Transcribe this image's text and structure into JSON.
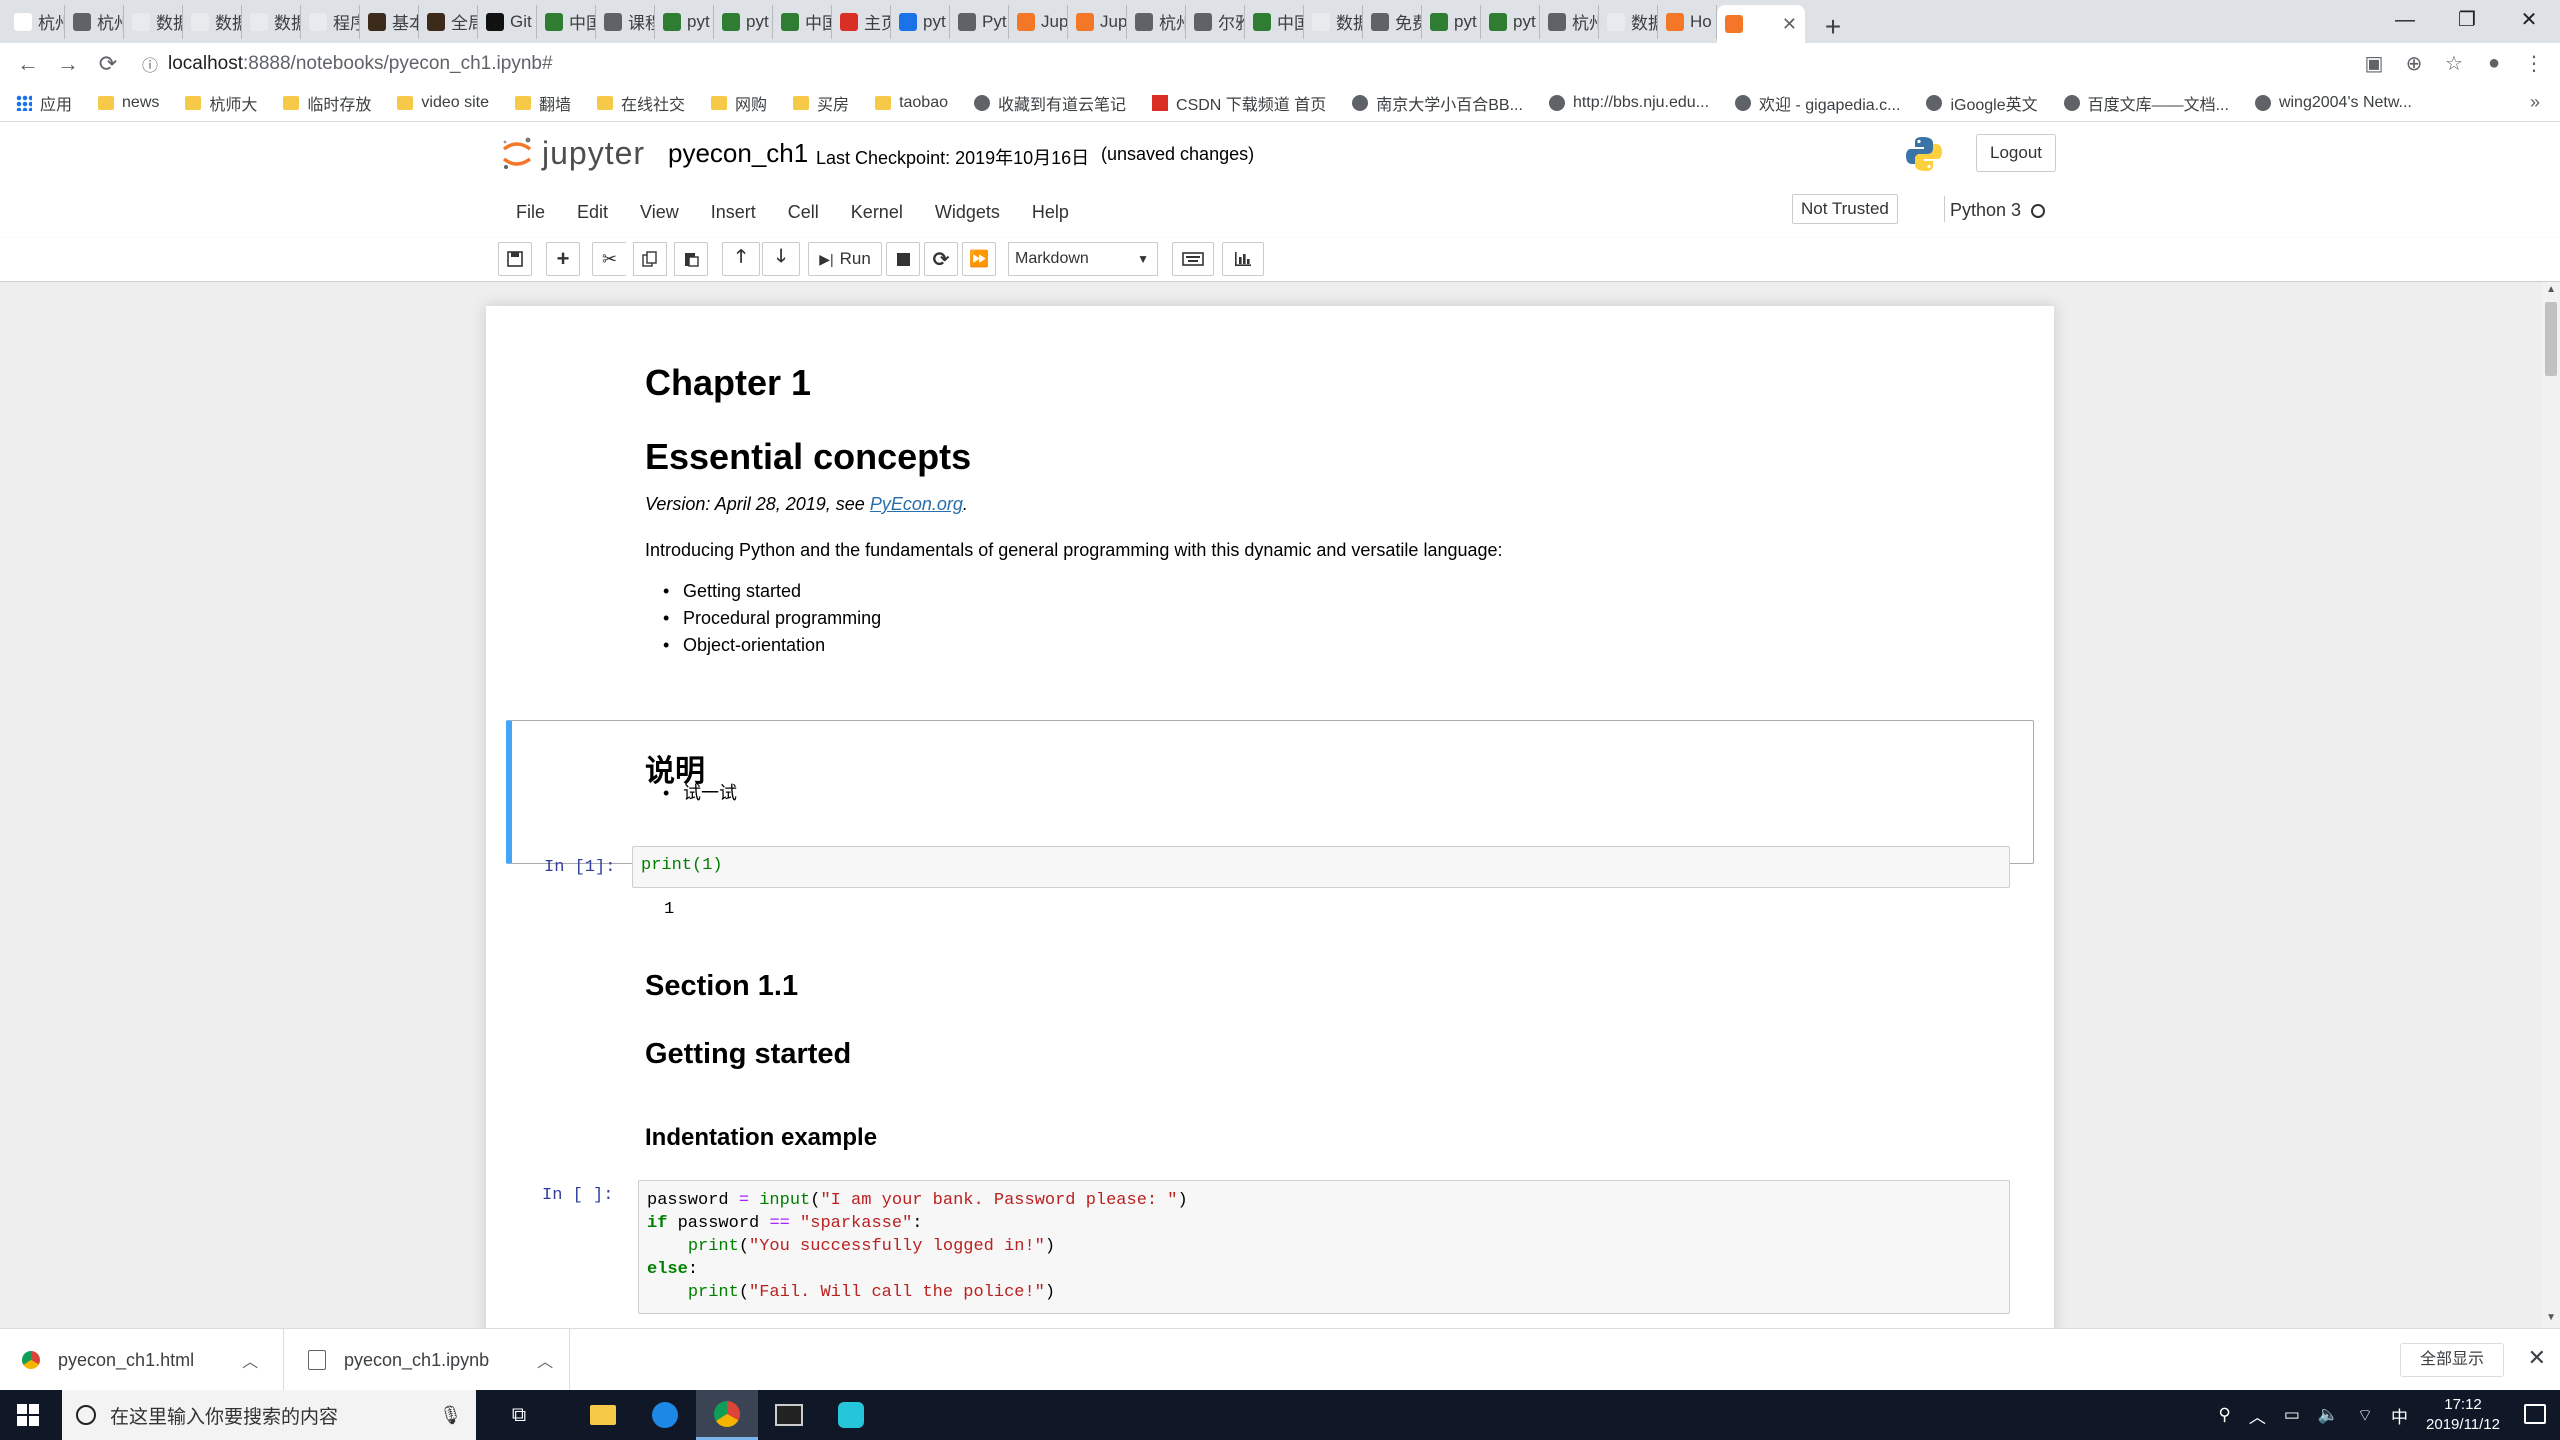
{
  "browser": {
    "tabs": [
      {
        "label": "杭州",
        "color": "#ffffff"
      },
      {
        "label": "杭州",
        "color": "#5f6368"
      },
      {
        "label": "数据",
        "color": "#e8eaed"
      },
      {
        "label": "数据",
        "color": "#e8eaed"
      },
      {
        "label": "数据",
        "color": "#e8eaed"
      },
      {
        "label": "程序",
        "color": "#e8eaed"
      },
      {
        "label": "基本",
        "color": "#3c2a1a"
      },
      {
        "label": "全局",
        "color": "#3c2a1a"
      },
      {
        "label": "Git",
        "color": "#111111"
      },
      {
        "label": "中国",
        "color": "#2e7d32"
      },
      {
        "label": "课程",
        "color": "#5f6368"
      },
      {
        "label": "pyt",
        "color": "#2e7d32"
      },
      {
        "label": "pyt",
        "color": "#2e7d32"
      },
      {
        "label": "中国",
        "color": "#2e7d32"
      },
      {
        "label": "主页",
        "color": "#d93025"
      },
      {
        "label": "pyt",
        "color": "#1a73e8"
      },
      {
        "label": "Pyt",
        "color": "#5f6368"
      },
      {
        "label": "Jup",
        "color": "#f37726"
      },
      {
        "label": "Jup",
        "color": "#f37726"
      },
      {
        "label": "杭州",
        "color": "#5f6368"
      },
      {
        "label": "尔雅",
        "color": "#5f6368"
      },
      {
        "label": "中国",
        "color": "#2e7d32"
      },
      {
        "label": "数据",
        "color": "#e8eaed"
      },
      {
        "label": "免费",
        "color": "#5f6368"
      },
      {
        "label": "pyt",
        "color": "#2e7d32"
      },
      {
        "label": "pyt",
        "color": "#2e7d32"
      },
      {
        "label": "杭州",
        "color": "#5f6368"
      },
      {
        "label": "数据",
        "color": "#e8eaed"
      },
      {
        "label": "Ho",
        "color": "#f37726"
      }
    ],
    "active_tab": {
      "label": "",
      "color": "#f37726",
      "close": "✕"
    },
    "new_tab": "+",
    "window": {
      "minimize": "—",
      "restore": "❐",
      "close": "✕"
    },
    "nav": {
      "back": "←",
      "forward": "→",
      "reload": "⟳"
    },
    "url_host": "localhost",
    "url_path": ":8888/notebooks/pyecon_ch1.ipynb#",
    "bookmarks": [
      {
        "label": "应用",
        "icon": "apps"
      },
      {
        "label": "news",
        "icon": "folder"
      },
      {
        "label": "杭师大",
        "icon": "folder"
      },
      {
        "label": "临时存放",
        "icon": "folder"
      },
      {
        "label": "video site",
        "icon": "folder"
      },
      {
        "label": "翻墙",
        "icon": "folder"
      },
      {
        "label": "在线社交",
        "icon": "folder"
      },
      {
        "label": "网购",
        "icon": "folder"
      },
      {
        "label": "买房",
        "icon": "folder"
      },
      {
        "label": "taobao",
        "icon": "folder"
      },
      {
        "label": "收藏到有道云笔记",
        "icon": "globe"
      },
      {
        "label": "CSDN 下载频道 首页",
        "icon": "csdn"
      },
      {
        "label": "南京大学小百合BB...",
        "icon": "globe"
      },
      {
        "label": "http://bbs.nju.edu...",
        "icon": "globe"
      },
      {
        "label": "欢迎 - gigapedia.c...",
        "icon": "globe"
      },
      {
        "label": "iGoogle英文",
        "icon": "globe"
      },
      {
        "label": "百度文库——文档...",
        "icon": "globe"
      },
      {
        "label": "wing2004's Netw...",
        "icon": "globe"
      }
    ],
    "bookmarks_more": "»"
  },
  "jupyter": {
    "logo_text": "jupyter",
    "notebook_name": "pyecon_ch1",
    "checkpoint": "Last Checkpoint: 2019年10月16日",
    "unsaved": "(unsaved changes)",
    "logout": "Logout",
    "menus": [
      "File",
      "Edit",
      "View",
      "Insert",
      "Cell",
      "Kernel",
      "Widgets",
      "Help"
    ],
    "not_trusted": "Not Trusted",
    "kernel": "Python 3",
    "toolbar": {
      "run": "Run",
      "cell_type": "Markdown"
    },
    "colors": {
      "accent": "#42a5f5",
      "prompt": "#303f9f",
      "link": "#296eaa"
    }
  },
  "notebook": {
    "chapter": "Chapter 1",
    "title": "Essential concepts",
    "version_prefix": "Version: April 28, 2019, see ",
    "version_link": "PyEcon.org",
    "version_suffix": ".",
    "intro": "Introducing Python and the fundamentals of general programming with this dynamic and versatile language:",
    "topics": [
      "Getting started",
      "Procedural programming",
      "Object-orientation"
    ],
    "note_heading": "说明",
    "note_items": [
      "试一试"
    ],
    "cell1_prompt": "In  [1]:",
    "cell1_code": "print(1)",
    "cell1_output": "1",
    "section": "Section 1.1",
    "section_title": "Getting started",
    "subsection": "Indentation example",
    "cell2_prompt": "In  [ ]:",
    "cell2_code": [
      "password = input(\"I am your bank. Password please: \")",
      "if password == \"sparkasse\":",
      "    print(\"You successfully logged in!\")",
      "else:",
      "    print(\"Fail. Will call the police!\")"
    ]
  },
  "downloads": [
    {
      "name": "pyecon_ch1.html"
    },
    {
      "name": "pyecon_ch1.ipynb"
    }
  ],
  "show_all": "全部显示",
  "taskbar": {
    "search_placeholder": "在这里输入你要搜索的内容",
    "time": "17:12",
    "date": "2019/11/12",
    "ime": "中"
  }
}
